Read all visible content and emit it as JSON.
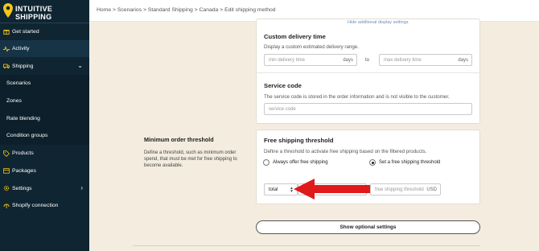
{
  "brand": {
    "line1": "INTUITIVE",
    "line2": "SHIPPING",
    "accent": "#f5c518"
  },
  "sidebar": {
    "items": [
      {
        "label": "Get started",
        "icon": "gift-icon"
      },
      {
        "label": "Activity",
        "icon": "activity-icon"
      },
      {
        "label": "Shipping",
        "icon": "truck-icon"
      },
      {
        "label": "Scenarios"
      },
      {
        "label": "Zones"
      },
      {
        "label": "Rate blending"
      },
      {
        "label": "Condition groups"
      },
      {
        "label": "Products",
        "icon": "tag-icon"
      },
      {
        "label": "Packages",
        "icon": "package-icon"
      },
      {
        "label": "Settings",
        "icon": "gear-icon"
      },
      {
        "label": "Shopify connection",
        "icon": "plug-icon"
      }
    ]
  },
  "breadcrumb": {
    "text": "Home > Scenarios > Standard Shipping > Canada > Edit shipping method"
  },
  "display_settings": {
    "hide_link": "Hide additional display settings"
  },
  "custom_delivery": {
    "title": "Custom delivery time",
    "desc": "Display a custom estimated delivery range.",
    "min_placeholder": "min delivery time",
    "min_suffix": "days",
    "to_label": "to",
    "max_placeholder": "max delivery time",
    "max_suffix": "days"
  },
  "service_code": {
    "title": "Service code",
    "desc": "The service code is stored in the order information and is not visible to the customer.",
    "placeholder": "service code"
  },
  "min_order": {
    "title": "Minimum order threshold",
    "desc": "Define a threshold, such as minimum order spend, that must be met for free shipping to become available."
  },
  "free_shipping": {
    "title": "Free shipping threshold",
    "desc": "Define a threshold to activate free shipping based on the filtered products.",
    "option_always": "Always offer free shipping",
    "option_set": "Set a free shipping threshold",
    "select_value": "total",
    "threshold_placeholder": "free shipping threshold",
    "currency": "USD"
  },
  "optional_button": "Show optional settings",
  "colors": {
    "sidebar_bg": "#0f2532",
    "page_bg": "#f3ecdf",
    "arrow": "#e0191b"
  }
}
